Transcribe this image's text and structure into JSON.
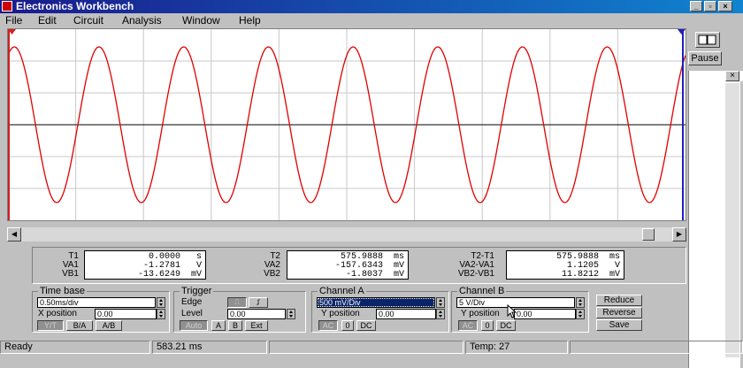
{
  "window": {
    "title": "Electronics Workbench"
  },
  "menu": {
    "items": [
      "File",
      "Edit",
      "Circuit",
      "Analysis",
      "Window",
      "Help"
    ]
  },
  "right_panel": {
    "pause_label": "Pause"
  },
  "readouts": {
    "col1": {
      "labels": [
        "T1",
        "VA1",
        "VB1"
      ],
      "values": [
        "0.0000   s",
        "-1.2781   V",
        "-13.6249  mV"
      ]
    },
    "col2": {
      "labels": [
        "T2",
        "VA2",
        "VB2"
      ],
      "values": [
        "575.9888  ms",
        "-157.6343  mV",
        "-1.8037  mV"
      ]
    },
    "col3": {
      "labels": [
        "T2-T1",
        "VA2-VA1",
        "VB2-VB1"
      ],
      "values": [
        "575.9888  ms",
        "1.1205   V",
        "11.8212  mV"
      ]
    }
  },
  "timebase": {
    "title": "Time base",
    "scale": "0.50ms/div",
    "xpos_label": "X position",
    "xpos": "0.00",
    "modes": [
      "Y/T",
      "B/A",
      "A/B"
    ]
  },
  "trigger": {
    "title": "Trigger",
    "edge_label": "Edge",
    "level_label": "Level",
    "level": "0.00",
    "sources": [
      "Auto",
      "A",
      "B",
      "Ext"
    ]
  },
  "channel_a": {
    "title": "Channel A",
    "scale": "500 mV/Div",
    "ypos_label": "Y position",
    "ypos": "0.00",
    "coupling": [
      "AC",
      "0",
      "DC"
    ]
  },
  "channel_b": {
    "title": "Channel B",
    "scale": "5 V/Div",
    "ypos_label": "Y position",
    "ypos": "0.00",
    "coupling": [
      "AC",
      "0",
      "DC"
    ]
  },
  "actions": {
    "reduce": "Reduce",
    "reverse": "Reverse",
    "save": "Save"
  },
  "status": {
    "ready": "Ready",
    "time": "583.21 ms",
    "temp": "Temp:  27"
  },
  "colors": {
    "trace": "#e00000",
    "cursor1": "#d02020",
    "cursor2": "#2020c0",
    "title_bar": "#0a246a"
  },
  "chart_data": {
    "type": "line",
    "title": "",
    "series": [
      {
        "values_shape": "sine"
      }
    ],
    "grid": true,
    "cycles_visible": 8,
    "ylim": [
      -1,
      1
    ]
  }
}
